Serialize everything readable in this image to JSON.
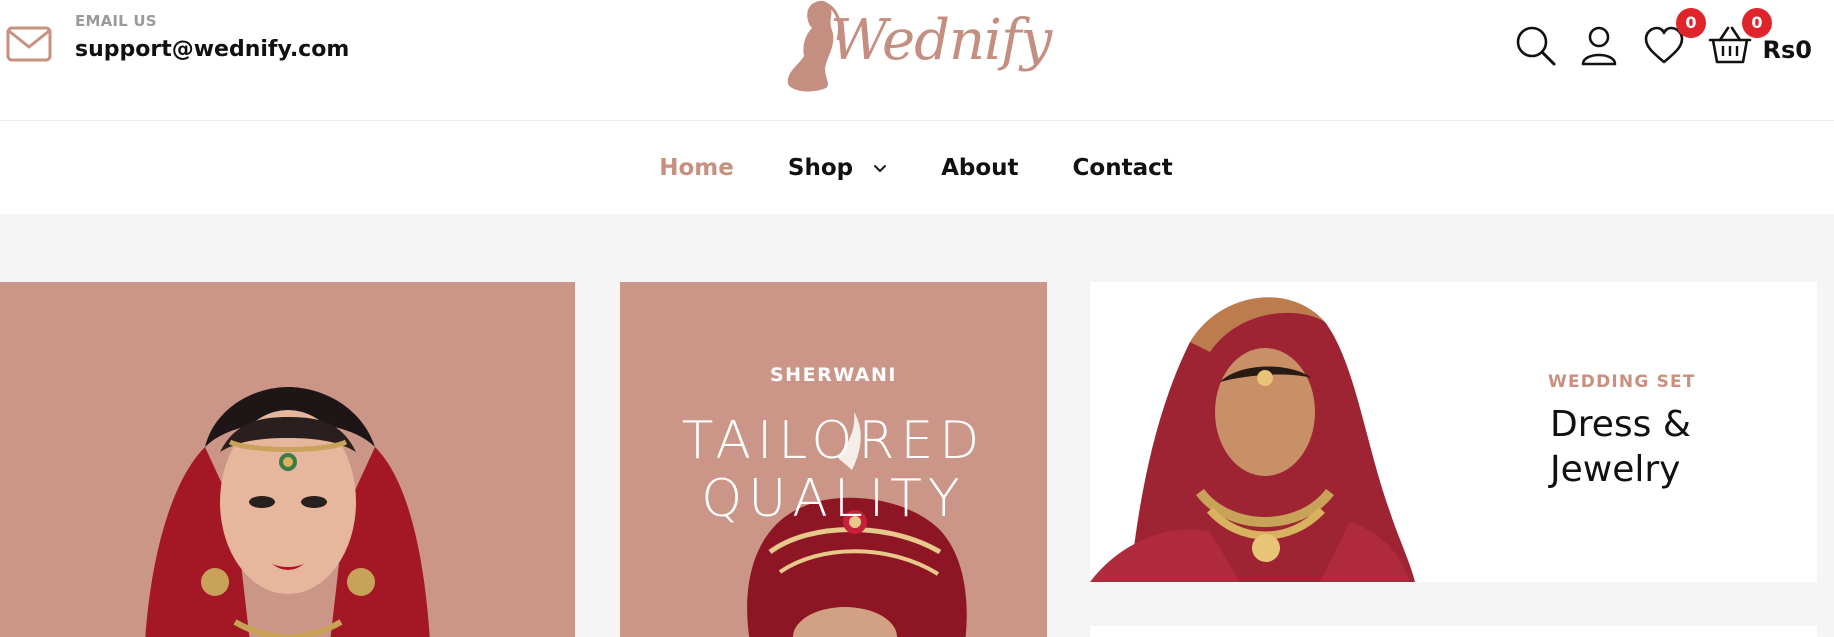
{
  "header": {
    "email_label": "EMAIL US",
    "email_value": "support@wednify.com",
    "logo_text": "Wednify",
    "wishlist_count": "0",
    "cart_count": "0",
    "cart_total": "Rs0"
  },
  "nav": {
    "items": [
      {
        "label": "Home",
        "active": true
      },
      {
        "label": "Shop",
        "has_dropdown": true
      },
      {
        "label": "About"
      },
      {
        "label": "Contact"
      }
    ]
  },
  "banners": {
    "sherwani": {
      "label": "SHERWANI",
      "title_line1": "TAILORED",
      "title_line2": "QUALITY"
    },
    "wedding_set": {
      "label": "WEDDING SET",
      "title_line1": "Dress &",
      "title_line2": "Jewelry"
    }
  },
  "colors": {
    "accent": "#c8907f",
    "banner_bg": "#cb9687",
    "badge": "#e0242b",
    "page_bg": "#f5f5f5"
  },
  "icons": [
    "mail-icon",
    "search-icon",
    "user-icon",
    "heart-icon",
    "basket-icon",
    "chevron-down-icon"
  ]
}
